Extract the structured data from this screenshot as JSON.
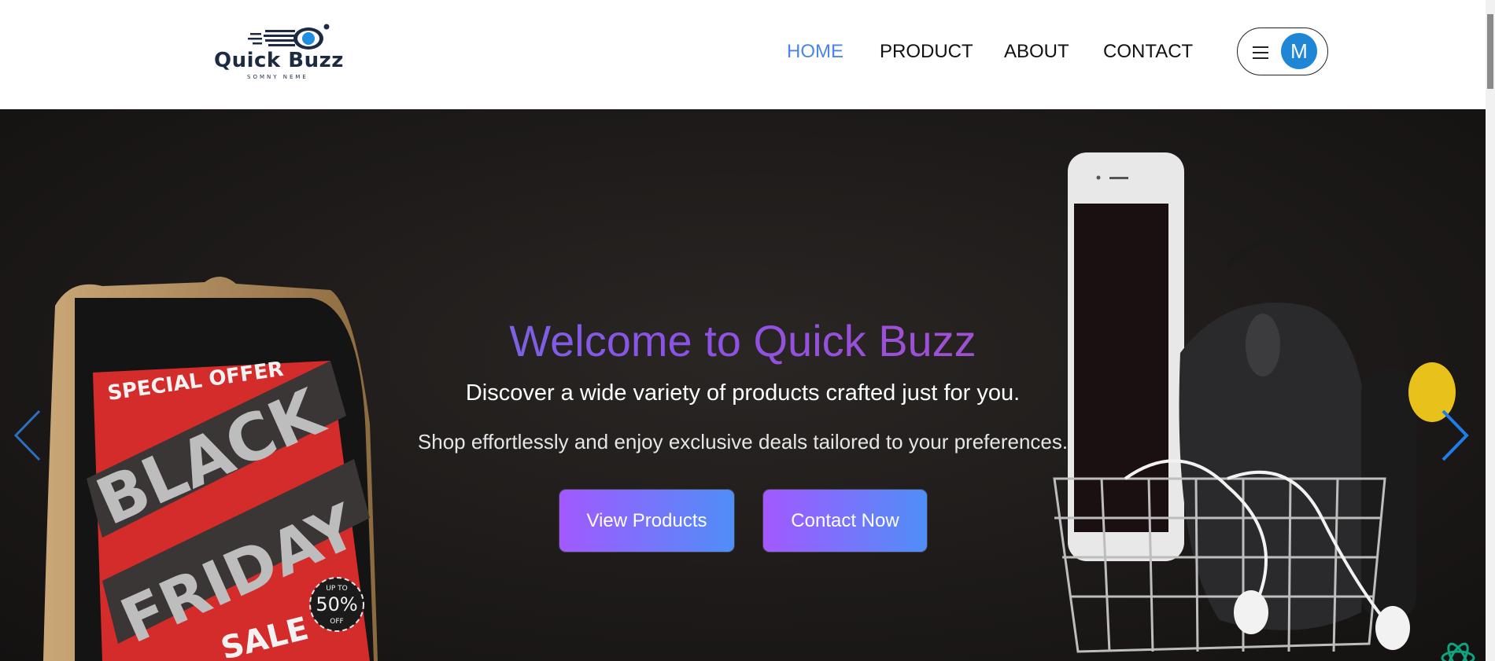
{
  "brand": {
    "name": "Quick Buzz",
    "tagline": "SOMNY NEME"
  },
  "nav": {
    "items": [
      {
        "label": "HOME",
        "active": true
      },
      {
        "label": "PRODUCT",
        "active": false
      },
      {
        "label": "ABOUT",
        "active": false
      },
      {
        "label": "CONTACT",
        "active": false
      }
    ]
  },
  "user": {
    "avatar_initial": "M",
    "avatar_color": "#1f86d6",
    "menu_icon": "hamburger-icon"
  },
  "hero": {
    "title": "Welcome to Quick Buzz",
    "subtitle": "Discover a wide variety of products crafted just for you.",
    "description": "Shop effortlessly and enjoy exclusive deals tailored to your preferences.",
    "buttons": {
      "view_products": "View Products",
      "contact_now": "Contact Now"
    },
    "carousel": {
      "prev_icon": "chevron-left-icon",
      "next_icon": "chevron-right-icon"
    },
    "image_left": {
      "badge_top": "SPECIAL OFFER",
      "word1": "BLACK",
      "word2": "FRIDAY",
      "word3": "SALE",
      "discount_top": "UP TO",
      "discount_value": "50%",
      "discount_bottom": "OFF"
    }
  },
  "colors": {
    "nav_active": "#4a86e8",
    "button_gradient_start": "#a259ff",
    "button_gradient_end": "#4f8ef7",
    "hero_bg": "#1d1a19"
  },
  "floating": {
    "assistant_icon": "ai-assistant-icon"
  }
}
